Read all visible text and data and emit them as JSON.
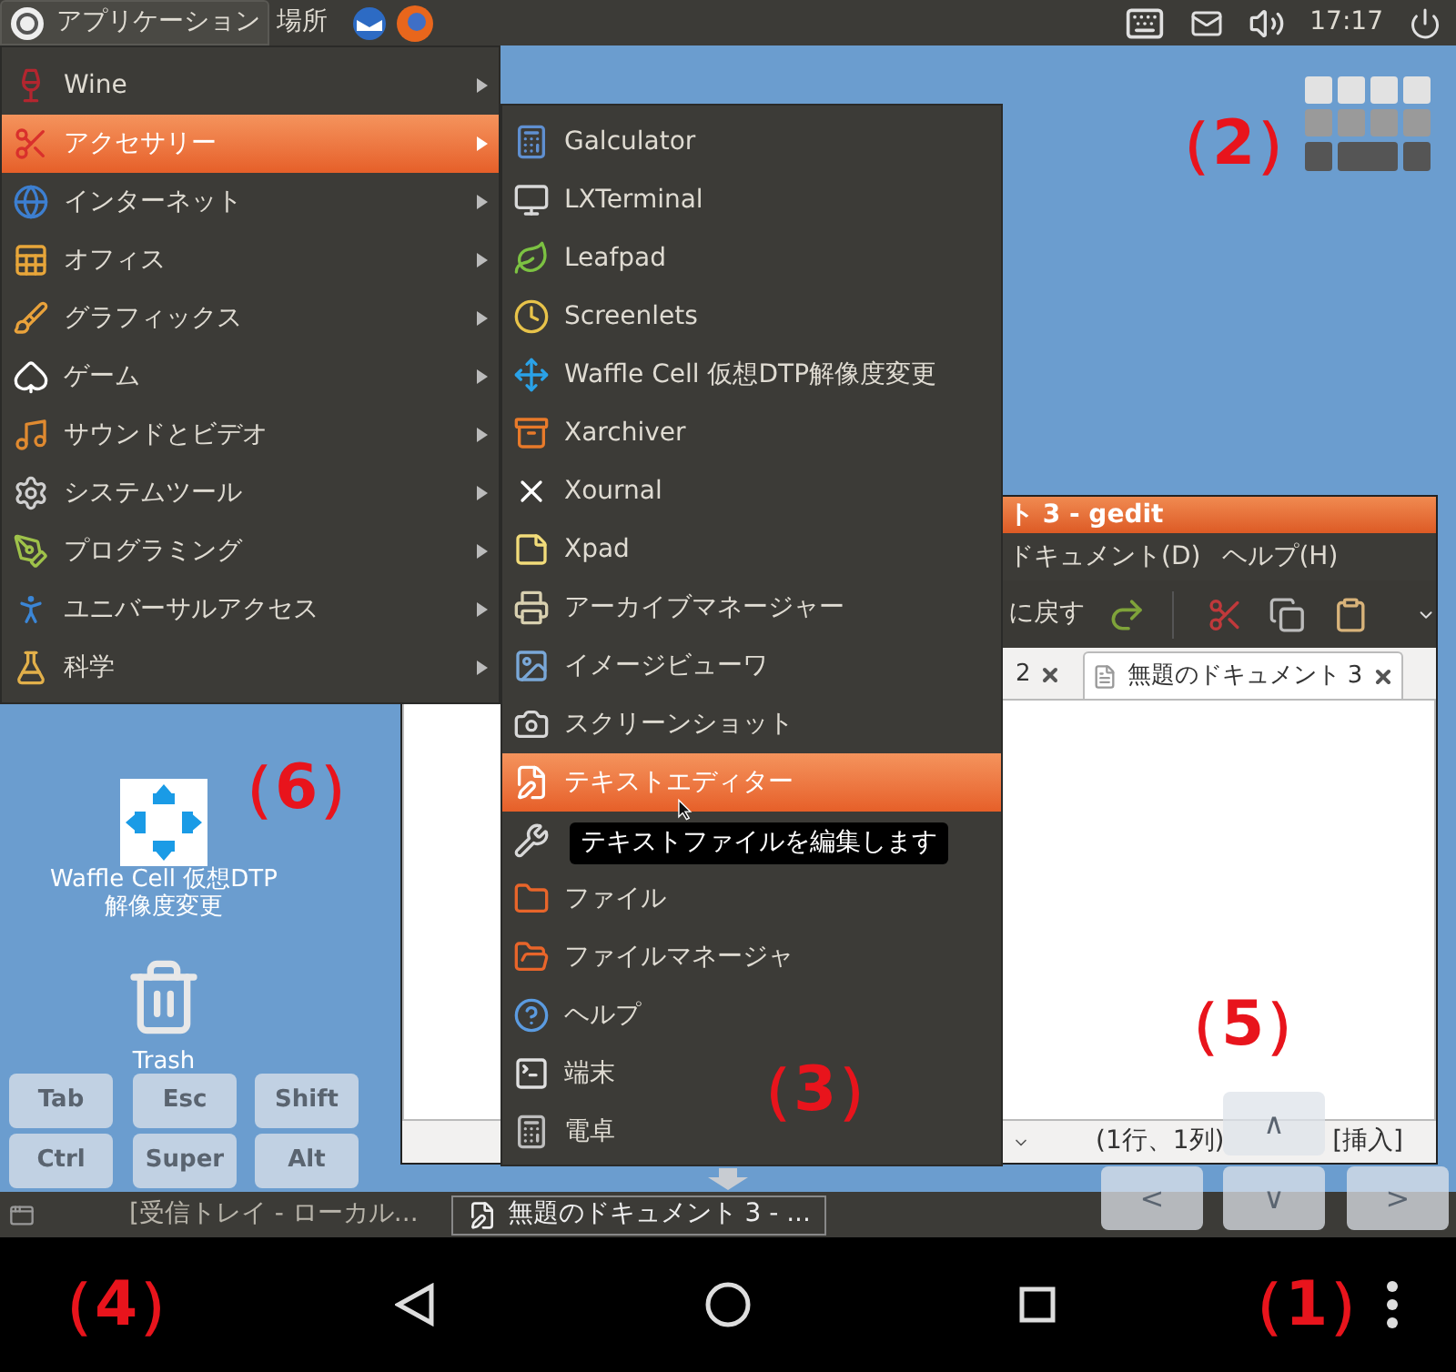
{
  "top_panel": {
    "menus": [
      {
        "label": "アプリケーション",
        "selected": true
      },
      {
        "label": "場所",
        "selected": false
      }
    ],
    "clock": "17:17"
  },
  "app_menu": {
    "items": [
      {
        "label": "Wine",
        "selected": false
      },
      {
        "label": "アクセサリー",
        "selected": true
      },
      {
        "label": "インターネット",
        "selected": false
      },
      {
        "label": "オフィス",
        "selected": false
      },
      {
        "label": "グラフィックス",
        "selected": false
      },
      {
        "label": "ゲーム",
        "selected": false
      },
      {
        "label": "サウンドとビデオ",
        "selected": false
      },
      {
        "label": "システムツール",
        "selected": false
      },
      {
        "label": "プログラミング",
        "selected": false
      },
      {
        "label": "ユニバーサルアクセス",
        "selected": false
      },
      {
        "label": "科学",
        "selected": false
      }
    ]
  },
  "submenu": {
    "items": [
      {
        "label": "Galculator",
        "selected": false
      },
      {
        "label": "LXTerminal",
        "selected": false
      },
      {
        "label": "Leafpad",
        "selected": false
      },
      {
        "label": "Screenlets",
        "selected": false
      },
      {
        "label": "Waffle Cell 仮想DTP解像度変更",
        "selected": false
      },
      {
        "label": "Xarchiver",
        "selected": false
      },
      {
        "label": "Xournal",
        "selected": false
      },
      {
        "label": "Xpad",
        "selected": false
      },
      {
        "label": "アーカイブマネージャー",
        "selected": false
      },
      {
        "label": "イメージビューワ",
        "selected": false
      },
      {
        "label": "スクリーンショット",
        "selected": false
      },
      {
        "label": "テキストエディター",
        "selected": true
      },
      {
        "selected": false
      },
      {
        "label": "ファイル",
        "selected": false
      },
      {
        "label": "ファイルマネージャ",
        "selected": false
      },
      {
        "label": "ヘルプ",
        "selected": false
      },
      {
        "label": "端末",
        "selected": false
      },
      {
        "label": "電卓",
        "selected": false
      }
    ]
  },
  "tooltip": "テキストファイルを編集します",
  "editor_window": {
    "title": "ト 3 - gedit",
    "menus": [
      "ドキュメント(D)",
      "ヘルプ(H)"
    ],
    "toolbar_label": "に戻す",
    "tabs": [
      {
        "label": "2",
        "selected": false
      },
      {
        "label": "無題のドキュメント 3",
        "selected": true
      }
    ],
    "status_position": "(1行、1列)",
    "status_mode": "[挿入]"
  },
  "desktop_icons": [
    {
      "lines": [
        "Waffle Cell 仮想DTP",
        "解像度変更"
      ]
    },
    {
      "lines": [
        "Trash"
      ]
    }
  ],
  "taskbar": {
    "tasks": [
      {
        "label": "[受信トレイ - ローカル...",
        "selected": false
      },
      {
        "label": "無題のドキュメント 3 - ...",
        "selected": true
      }
    ]
  },
  "modifier_keys": [
    "Tab",
    "Esc",
    "Shift",
    "Ctrl",
    "Super",
    "Alt"
  ],
  "arrow_keys": [
    "∧",
    "<",
    "∨",
    ">"
  ],
  "annotations": [
    "（1）",
    "（2）",
    "（3）",
    "（4）",
    "（5）",
    "（6）"
  ]
}
